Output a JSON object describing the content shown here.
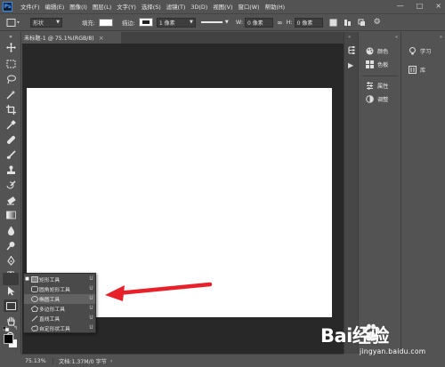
{
  "menubar": {
    "app_icon": "Ps",
    "items": [
      "文件(F)",
      "编辑(E)",
      "图像(I)",
      "图层(L)",
      "文字(Y)",
      "选择(S)",
      "滤镜(T)",
      "3D(D)",
      "视图(V)",
      "窗口(W)",
      "帮助(H)"
    ],
    "controls": [
      "—",
      "□",
      "×"
    ]
  },
  "options_bar": {
    "mode": "形状",
    "fill_label": "填充:",
    "stroke_label": "描边:",
    "stroke_width": "1 像素",
    "w_label": "W:",
    "w_value": "0 像素",
    "link_symbol": "∞",
    "h_label": "H:",
    "h_value": "0 像素"
  },
  "document": {
    "tab_title": "未标题-1 @ 75.1%(RGB/8)",
    "close_symbol": "×"
  },
  "flyout": {
    "items": [
      {
        "label": "矩形工具",
        "key": "U",
        "icon": "rectangle-icon",
        "selected": false
      },
      {
        "label": "圆角矩形工具",
        "key": "U",
        "icon": "rounded-rectangle-icon",
        "selected": false
      },
      {
        "label": "椭圆工具",
        "key": "U",
        "icon": "ellipse-icon",
        "selected": true
      },
      {
        "label": "多边形工具",
        "key": "U",
        "icon": "polygon-icon",
        "selected": false
      },
      {
        "label": "直线工具",
        "key": "U",
        "icon": "line-icon",
        "selected": false
      },
      {
        "label": "自定形状工具",
        "key": "U",
        "icon": "custom-shape-icon",
        "selected": false
      }
    ]
  },
  "panels": {
    "color": "颜色",
    "swatches": "色板",
    "properties": "属性",
    "adjustments": "调整",
    "learn": "学习",
    "libraries": "库"
  },
  "statusbar": {
    "zoom": "75.13%",
    "doc_info": "文档:1.37M/0 字节"
  },
  "watermark": {
    "logo": "Bai经验",
    "url": "jingyan.baidu.com"
  },
  "colors": {
    "ui_bg": "#535353",
    "canvas_bg": "#282828",
    "canvas": "#ffffff",
    "arrow": "#e8202a"
  }
}
